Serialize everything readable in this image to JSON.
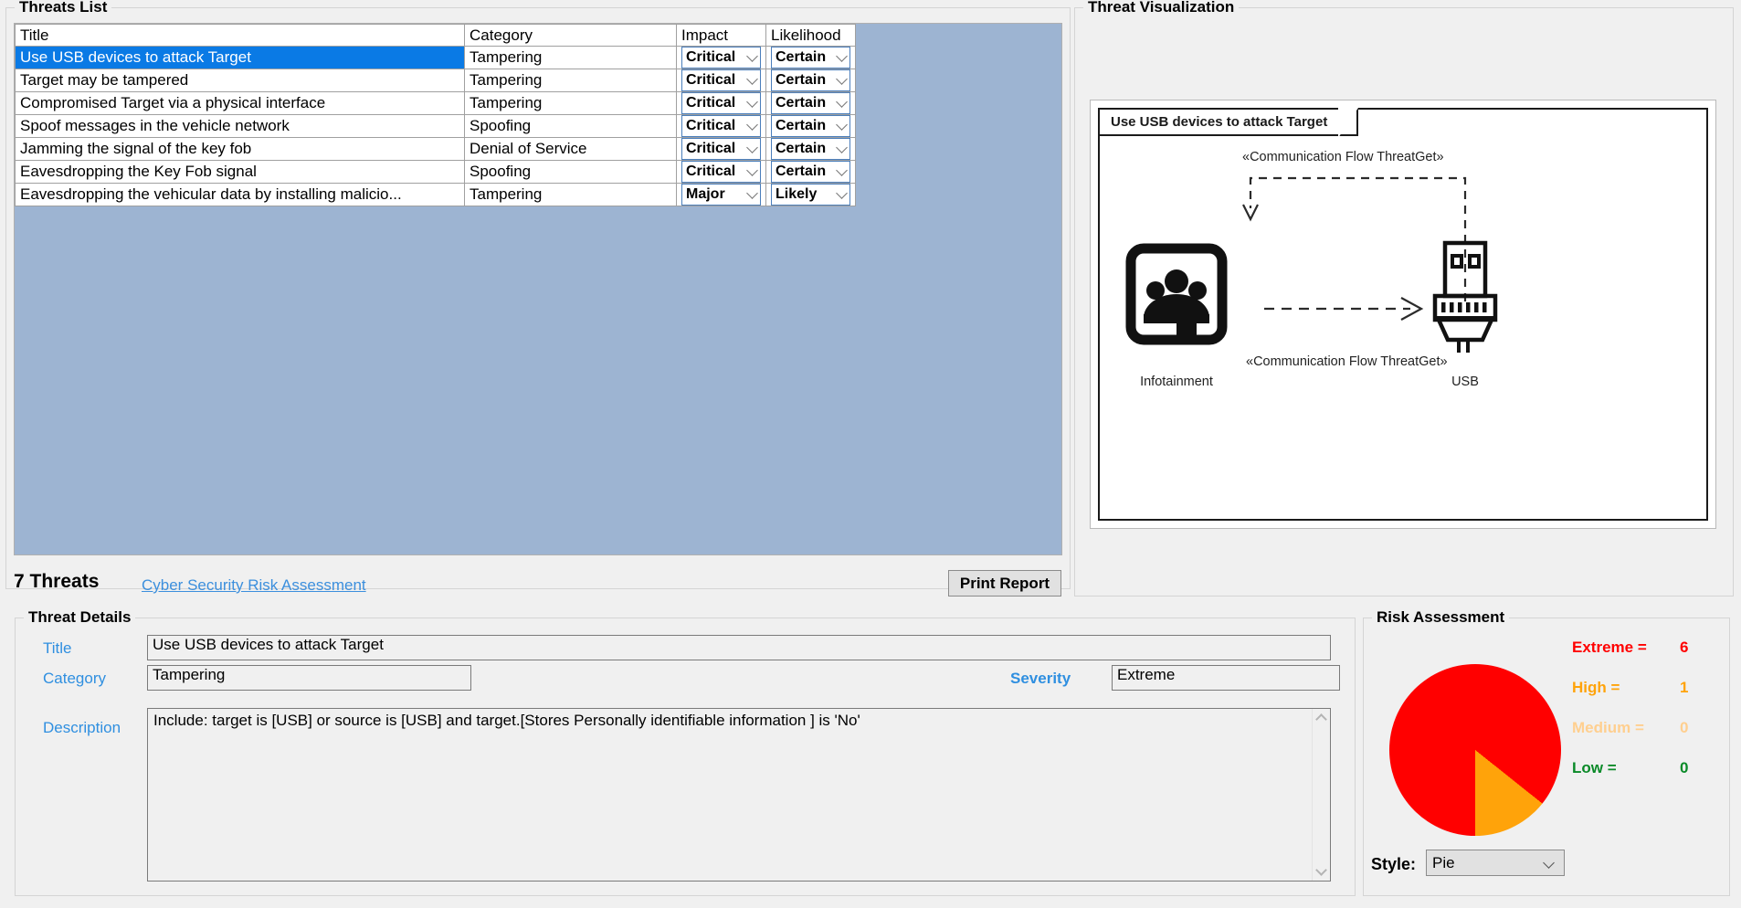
{
  "threats_list": {
    "group_title": "Threats List",
    "columns": [
      "Title",
      "Category",
      "Impact",
      "Likelihood"
    ],
    "rows": [
      {
        "title": "Use USB devices to attack Target",
        "category": "Tampering",
        "impact": "Critical",
        "likelihood": "Certain",
        "selected": true
      },
      {
        "title": "Target may be tampered",
        "category": "Tampering",
        "impact": "Critical",
        "likelihood": "Certain",
        "selected": false
      },
      {
        "title": "Compromised  Target via a physical interface",
        "category": "Tampering",
        "impact": "Critical",
        "likelihood": "Certain",
        "selected": false
      },
      {
        "title": "Spoof messages in the vehicle network",
        "category": "Spoofing",
        "impact": "Critical",
        "likelihood": "Certain",
        "selected": false
      },
      {
        "title": "Jamming the signal of the key fob",
        "category": "Denial of Service",
        "impact": "Critical",
        "likelihood": "Certain",
        "selected": false
      },
      {
        "title": "Eavesdropping the Key Fob signal",
        "category": "Spoofing",
        "impact": "Critical",
        "likelihood": "Certain",
        "selected": false
      },
      {
        "title": "Eavesdropping the vehicular data by installing malicio...",
        "category": "Tampering",
        "impact": "Major",
        "likelihood": "Likely",
        "selected": false
      }
    ],
    "count_label": "7 Threats",
    "link_label": "Cyber Security Risk Assessment",
    "print_button": "Print Report",
    "selection_color": "#0a7ae5",
    "surface_color": "#9db4d2"
  },
  "visualization": {
    "group_title": "Threat Visualization",
    "diagram_tab_label": "Use USB devices to attack Target",
    "edge_label_top": "«Communication Flow ThreatGet»",
    "edge_label_bottom": "«Communication Flow ThreatGet»",
    "node_left_label": "Infotainment",
    "node_right_label": "USB",
    "node_left_icon": "infotainment-screen-icon",
    "node_right_icon": "usb-connector-icon"
  },
  "threat_details": {
    "group_title": "Threat Details",
    "title_label": "Title",
    "title_value": "Use USB devices to attack Target",
    "category_label": "Category",
    "category_value": "Tampering",
    "severity_label": "Severity",
    "severity_value": "Extreme",
    "description_label": "Description",
    "description_value": "Include:   target is [USB] or source is  [USB] and  target.[Stores Personally identifiable information ] is 'No'"
  },
  "risk_assessment": {
    "group_title": "Risk Assessment",
    "style_label": "Style:",
    "style_value": "Pie",
    "legend": [
      {
        "name": "Extreme =",
        "value": "6",
        "color": "#ff0000"
      },
      {
        "name": "High =",
        "value": "1",
        "color": "#ffa30a"
      },
      {
        "name": "Medium =",
        "value": "0",
        "color": "#ffcf8f"
      },
      {
        "name": "Low =",
        "value": "0",
        "color": "#0a8a28"
      }
    ]
  },
  "chart_data": {
    "type": "pie",
    "title": "Risk Assessment",
    "categories": [
      "Extreme",
      "High",
      "Medium",
      "Low"
    ],
    "values": [
      6,
      1,
      0,
      0
    ],
    "colors": [
      "#ff0000",
      "#ffa30a",
      "#ffcf8f",
      "#0a8a28"
    ],
    "total": 7,
    "legend_position": "right",
    "start_angle_deg": 0,
    "direction": "counterclockwise",
    "labels_shown": [
      "Extreme = 6",
      "High = 1",
      "Medium = 0",
      "Low = 0"
    ]
  }
}
